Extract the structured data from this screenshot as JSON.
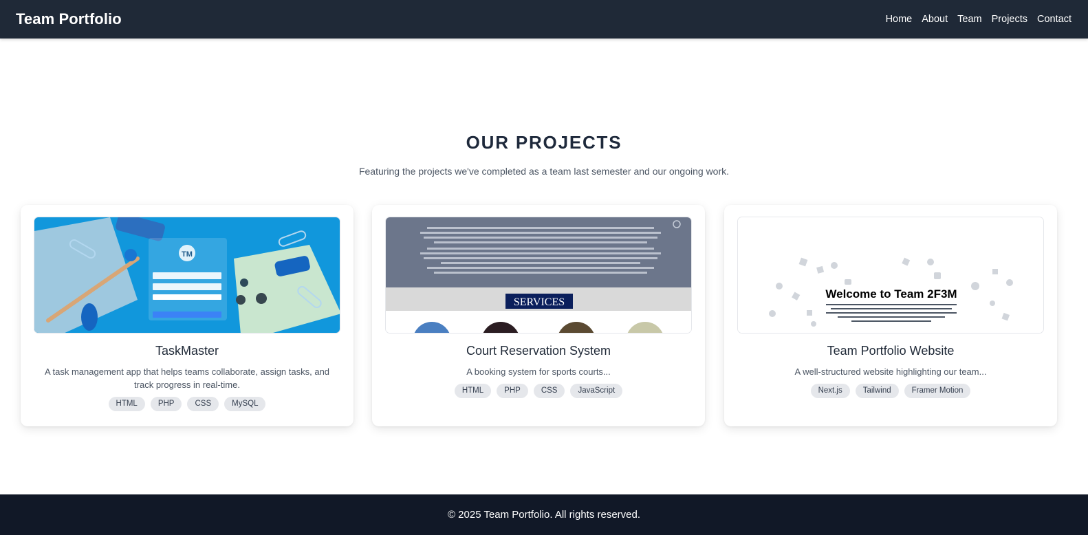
{
  "nav": {
    "brand": "Team Portfolio",
    "links": [
      "Home",
      "About",
      "Team",
      "Projects",
      "Contact"
    ]
  },
  "section": {
    "title": "OUR PROJECTS",
    "subtitle": "Featuring the projects we've completed as a team last semester and our ongoing work."
  },
  "projects": [
    {
      "title": "TaskMaster",
      "description": "A task management app that helps teams collaborate, assign tasks, and track progress in real-time.",
      "tags": [
        "HTML",
        "PHP",
        "CSS",
        "MySQL"
      ],
      "image_label": "TM"
    },
    {
      "title": "Court Reservation System",
      "description": "A booking system for sports courts...",
      "tags": [
        "HTML",
        "PHP",
        "CSS",
        "JavaScript"
      ],
      "image_label": "SERVICES"
    },
    {
      "title": "Team Portfolio Website",
      "description": "A well-structured website highlighting our team...",
      "tags": [
        "Next.js",
        "Tailwind",
        "Framer Motion"
      ],
      "image_label": "Welcome to Team 2F3M"
    }
  ],
  "footer": {
    "text": "© 2025 Team Portfolio. All rights reserved."
  },
  "colors": {
    "navbar_bg": "#1f2937",
    "footer_bg": "#111827",
    "tag_bg": "#e5e7eb",
    "heading": "#1e293b"
  }
}
